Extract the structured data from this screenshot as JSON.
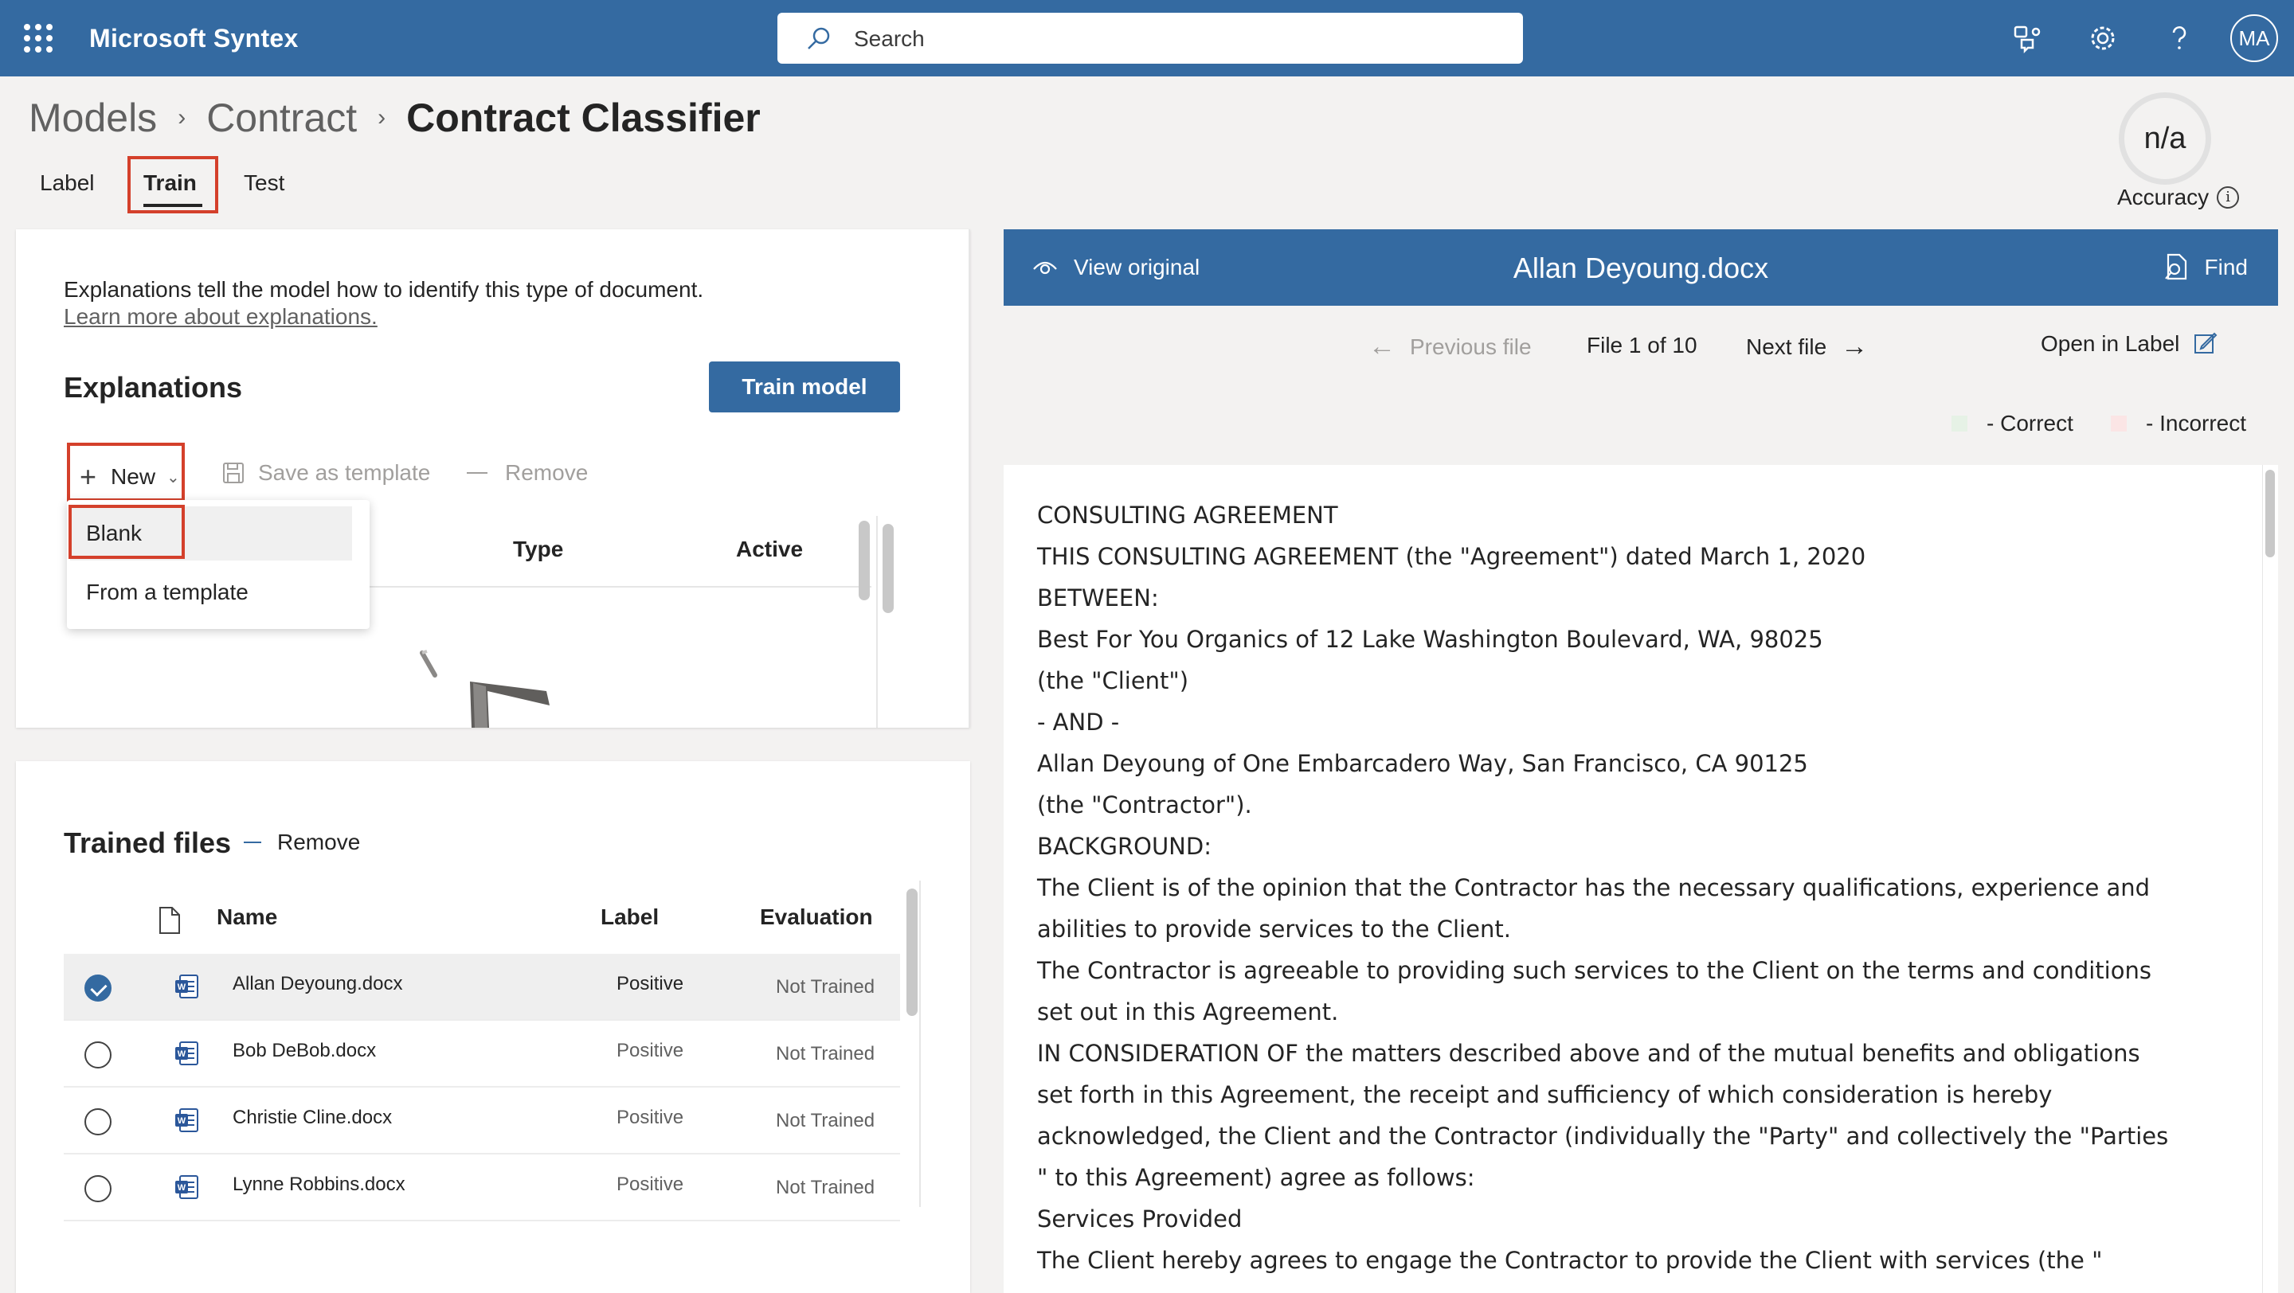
{
  "topbar": {
    "app_title": "Microsoft Syntex",
    "search_placeholder": "Search",
    "avatar_initials": "MA",
    "colors": {
      "bar": "#346aa1",
      "highlight": "#d4402b"
    }
  },
  "breadcrumb": [
    "Models",
    "Contract",
    "Contract Classifier"
  ],
  "tabs": [
    "Label",
    "Train",
    "Test"
  ],
  "accuracy": {
    "value": "n/a",
    "label": "Accuracy"
  },
  "explanations": {
    "description": "Explanations tell the model how to identify this type of document.",
    "learn_more": "Learn more about explanations.",
    "title": "Explanations",
    "train_button": "Train model",
    "toolbar": {
      "new": "New",
      "save_template": "Save as template",
      "remove": "Remove"
    },
    "columns": {
      "type": "Type",
      "active": "Active"
    },
    "dropdown": [
      "Blank",
      "From a template"
    ]
  },
  "trained_files": {
    "title": "Trained files",
    "remove": "Remove",
    "columns": {
      "name": "Name",
      "label": "Label",
      "evaluation": "Evaluation"
    },
    "rows": [
      {
        "name": "Allan Deyoung.docx",
        "label": "Positive",
        "evaluation": "Not Trained",
        "selected": true
      },
      {
        "name": "Bob DeBob.docx",
        "label": "Positive",
        "evaluation": "Not Trained",
        "selected": false
      },
      {
        "name": "Christie Cline.docx",
        "label": "Positive",
        "evaluation": "Not Trained",
        "selected": false
      },
      {
        "name": "Lynne Robbins.docx",
        "label": "Positive",
        "evaluation": "Not Trained",
        "selected": false
      }
    ]
  },
  "document": {
    "view_original": "View original",
    "title": "Allan Deyoung.docx",
    "find": "Find",
    "prev": "Previous file",
    "counter": "File 1 of 10",
    "next": "Next file",
    "open_in_label": "Open in Label",
    "legend": {
      "correct": "- Correct",
      "incorrect": "- Incorrect",
      "correct_color": "#e6f2e6",
      "incorrect_color": "#fbe5e5"
    },
    "lines": [
      "CONSULTING AGREEMENT",
      "THIS CONSULTING AGREEMENT (the \"Agreement\") dated March 1, 2020",
      "BETWEEN:",
      "Best For You Organics of 12 Lake Washington Boulevard, WA, 98025",
      "(the \"Client\")",
      "- AND -",
      "Allan Deyoung of One Embarcadero Way, San Francisco, CA 90125",
      "(the \"Contractor\").",
      "BACKGROUND:",
      "The Client is of the opinion that the Contractor has the necessary qualifications, experience and",
      "abilities to provide services to the Client.",
      "The Contractor is agreeable to providing such services to the Client on the terms and conditions",
      "set out in this Agreement.",
      "IN CONSIDERATION OF the matters described above and of the mutual benefits and obligations",
      "set forth in this Agreement, the receipt and sufficiency of which consideration is hereby",
      "acknowledged, the Client and the Contractor (individually the \"Party\" and collectively the \"Parties",
      "\" to this Agreement) agree as follows:",
      "Services Provided",
      "The Client hereby agrees to engage the Contractor to provide the Client with services (the \""
    ]
  }
}
